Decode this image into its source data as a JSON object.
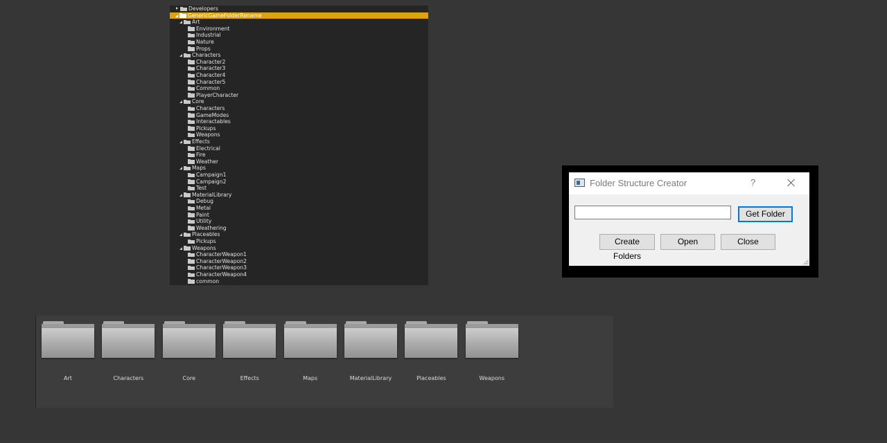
{
  "tree": {
    "top_row_label": "Developers",
    "selected_root": "GenericGameFolderRename",
    "items": [
      {
        "label": "Art",
        "level": 1,
        "expanded": true
      },
      {
        "label": "Environment",
        "level": 2
      },
      {
        "label": "Industrial",
        "level": 2
      },
      {
        "label": "Nature",
        "level": 2
      },
      {
        "label": "Props",
        "level": 2
      },
      {
        "label": "Characters",
        "level": 1,
        "expanded": true
      },
      {
        "label": "Character2",
        "level": 2
      },
      {
        "label": "Character3",
        "level": 2
      },
      {
        "label": "Character4",
        "level": 2
      },
      {
        "label": "Character5",
        "level": 2
      },
      {
        "label": "Common",
        "level": 2
      },
      {
        "label": "PlayerCharacter",
        "level": 2
      },
      {
        "label": "Core",
        "level": 1,
        "expanded": true
      },
      {
        "label": "Characters",
        "level": 2
      },
      {
        "label": "GameModes",
        "level": 2
      },
      {
        "label": "Interactables",
        "level": 2
      },
      {
        "label": "Pickups",
        "level": 2
      },
      {
        "label": "Weapons",
        "level": 2
      },
      {
        "label": "Effects",
        "level": 1,
        "expanded": true
      },
      {
        "label": "Electrical",
        "level": 2
      },
      {
        "label": "Fire",
        "level": 2
      },
      {
        "label": "Weather",
        "level": 2
      },
      {
        "label": "Maps",
        "level": 1,
        "expanded": true
      },
      {
        "label": "Campaign1",
        "level": 2
      },
      {
        "label": "Campaign2",
        "level": 2
      },
      {
        "label": "Test",
        "level": 2
      },
      {
        "label": "MaterialLibrary",
        "level": 1,
        "expanded": true
      },
      {
        "label": "Debug",
        "level": 2
      },
      {
        "label": "Metal",
        "level": 2
      },
      {
        "label": "Paint",
        "level": 2
      },
      {
        "label": "Utility",
        "level": 2
      },
      {
        "label": "Weathering",
        "level": 2
      },
      {
        "label": "Placeables",
        "level": 1,
        "expanded": true
      },
      {
        "label": "Pickups",
        "level": 2
      },
      {
        "label": "Weapons",
        "level": 1,
        "expanded": true
      },
      {
        "label": "CharacterWeapon1",
        "level": 2
      },
      {
        "label": "CharacterWeapon2",
        "level": 2
      },
      {
        "label": "CharacterWeapon3",
        "level": 2
      },
      {
        "label": "CharacterWeapon4",
        "level": 2
      },
      {
        "label": "common",
        "level": 2
      }
    ]
  },
  "browser": {
    "folders": [
      "Art",
      "Characters",
      "Core",
      "Effects",
      "Maps",
      "MaterialLibrary",
      "Placeables",
      "Weapons"
    ]
  },
  "dialog": {
    "title": "Folder Structure Creator",
    "help_label": "?",
    "path_value": "",
    "get_folder_label": "Get Folder",
    "create_folders_label": "Create Folders",
    "open_label": "Open",
    "close_label": "Close"
  },
  "colors": {
    "selection": "#dea309",
    "dialog_focus": "#0078d7"
  }
}
